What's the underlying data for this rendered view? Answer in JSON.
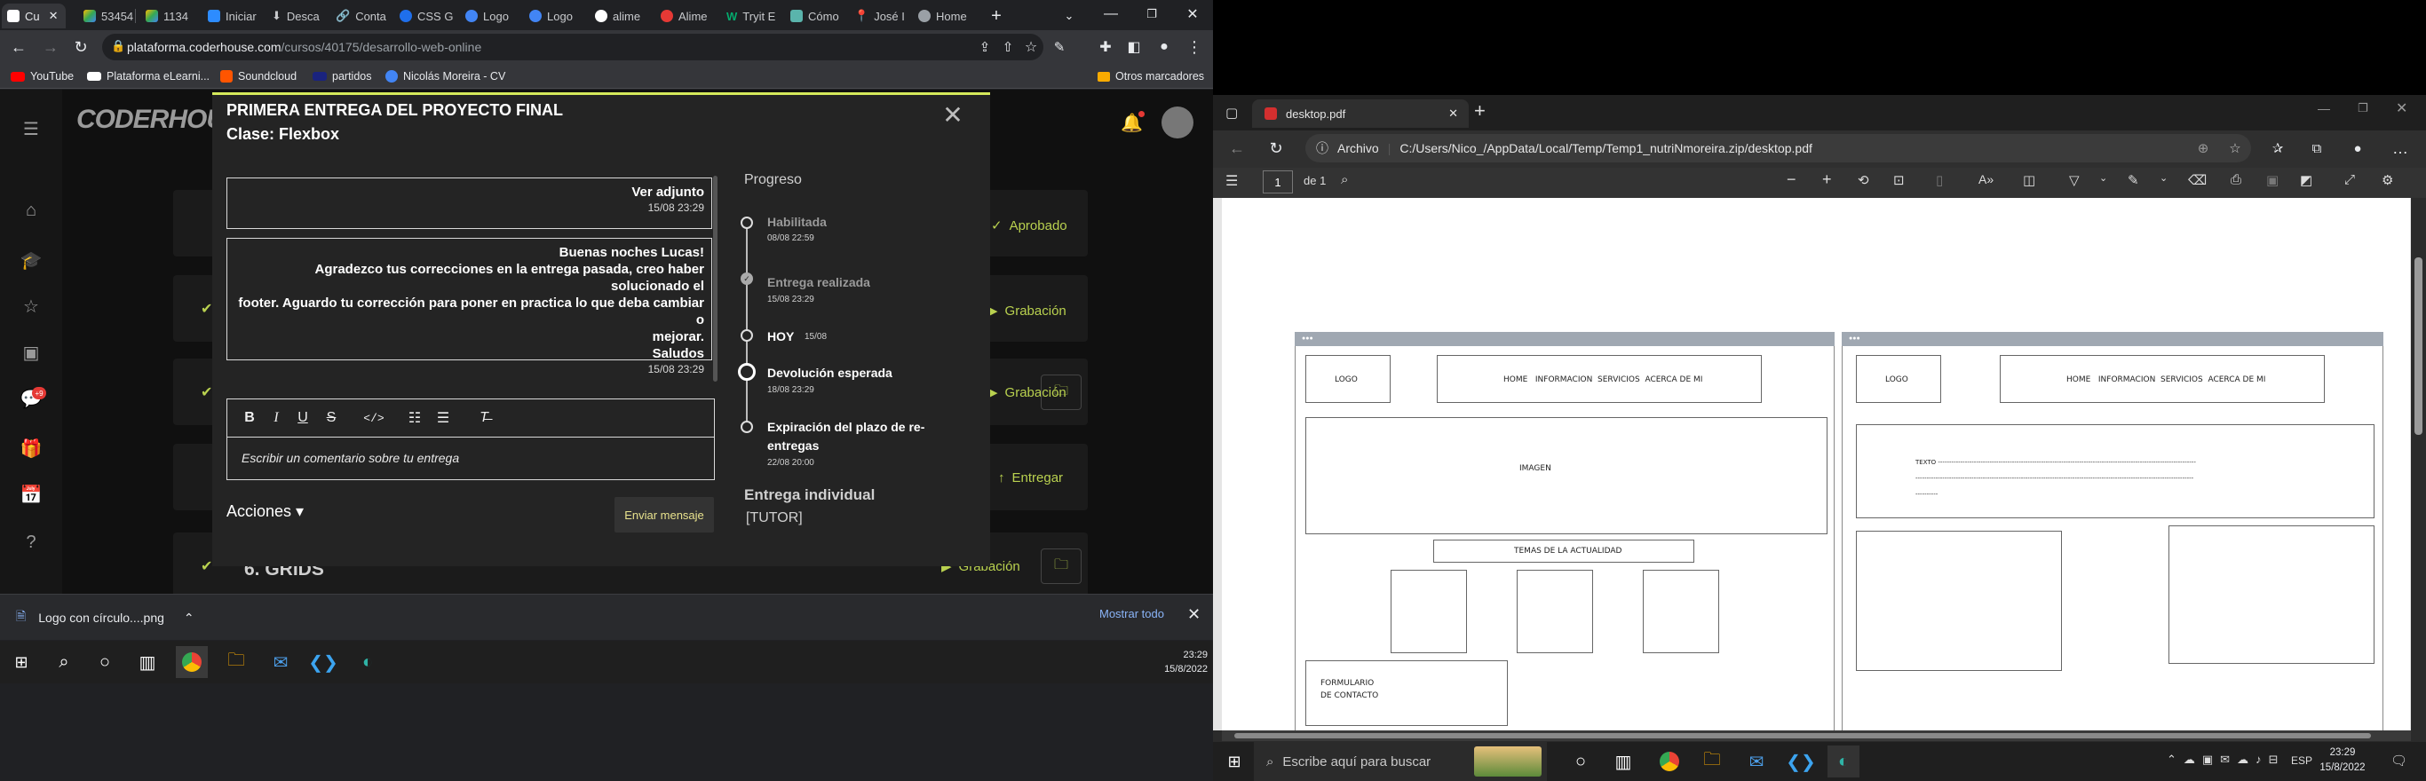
{
  "left_browser": {
    "tabs": [
      "Cu",
      "53454",
      "1134",
      "Iniciar",
      "Desca",
      "Conta",
      "CSS G",
      "Logo",
      "Logo",
      "alime",
      "Alime",
      "Tryit E",
      "Cómo",
      "José I",
      "Home"
    ],
    "url_domain": "plataforma.coderhouse.com",
    "url_path": "/cursos/40175/desarrollo-web-online",
    "bookmarks": [
      "YouTube",
      "Plataforma eLearni...",
      "Soundcloud",
      "partidos",
      "Nicolás Moreira - CV"
    ],
    "other_bookmarks": "Otros marcadores"
  },
  "site": {
    "brand": "CODERHOUSE",
    "notification_badge": "+9",
    "bg_buttons": [
      "Aprobado",
      "Grabación",
      "Grabación",
      "Entregar",
      "Grabación"
    ],
    "grids_title": "6. GRIDS"
  },
  "modal": {
    "title": "PRIMERA ENTREGA DEL PROYECTO FINAL",
    "subtitle": "Clase: Flexbox",
    "close": "✕",
    "messages": [
      {
        "text": "Ver adjunto",
        "date": "15/08 23:29"
      },
      {
        "lines": [
          "Buenas noches Lucas!",
          "Agradezco tus correcciones en la entrega pasada, creo haber solucionado el",
          "footer. Aguardo tu corrección para poner en practica lo que deba cambiar o",
          "mejorar.",
          "Saludos"
        ],
        "date": "15/08 23:29"
      }
    ],
    "editor_placeholder": "Escribir un comentario sobre tu entrega",
    "acciones": "Acciones ▾",
    "send": "Enviar mensaje",
    "progress_title": "Progreso",
    "progress": [
      {
        "label": "Habilitada",
        "date": "08/08 22:59"
      },
      {
        "label": "Entrega realizada",
        "date": "15/08 23:29"
      },
      {
        "label": "HOY",
        "date": "15/08"
      },
      {
        "label": "Devolución esperada",
        "date": "18/08 23:29"
      },
      {
        "label_lines": [
          "Expiración del plazo de re-",
          "entregas"
        ],
        "date": "22/08 20:00"
      }
    ],
    "individual": "Entrega individual",
    "tutor": "[TUTOR]"
  },
  "downloads": {
    "file": "Logo con círculo....png",
    "show_all": "Mostrar todo"
  },
  "left_clock": {
    "time": "23:29",
    "date": "15/8/2022"
  },
  "edge": {
    "tab_title": "desktop.pdf",
    "archivo": "Archivo",
    "path": "C:/Users/Nico_/AppData/Local/Temp/Temp1_nutriNmoreira.zip/desktop.pdf",
    "page_current": "1",
    "page_total": "de 1"
  },
  "wireframe_left": {
    "logo": "LOGO",
    "nav": "HOME   INFORMACION  SERVICIOS  ACERCA DE MI",
    "imagen": "IMAGEN",
    "temas": "TEMAS DE LA ACTUALIDAD",
    "form1": "FORMULARIO",
    "form2": "DE CONTACTO"
  },
  "wireframe_right": {
    "logo": "LOGO",
    "nav": "HOME   INFORMACION  SERVICIOS  ACERCA DE MI",
    "texto1": "TEXTO -------------------------------------------------------------------------------------------------------------------",
    "texto2": "----------------------------------------------------------------------------------------------------------------------------",
    "texto3": "----------"
  },
  "taskbar": {
    "search": "Escribe aquí para buscar",
    "lang": "ESP",
    "time": "23:29",
    "date": "15/8/2022"
  }
}
